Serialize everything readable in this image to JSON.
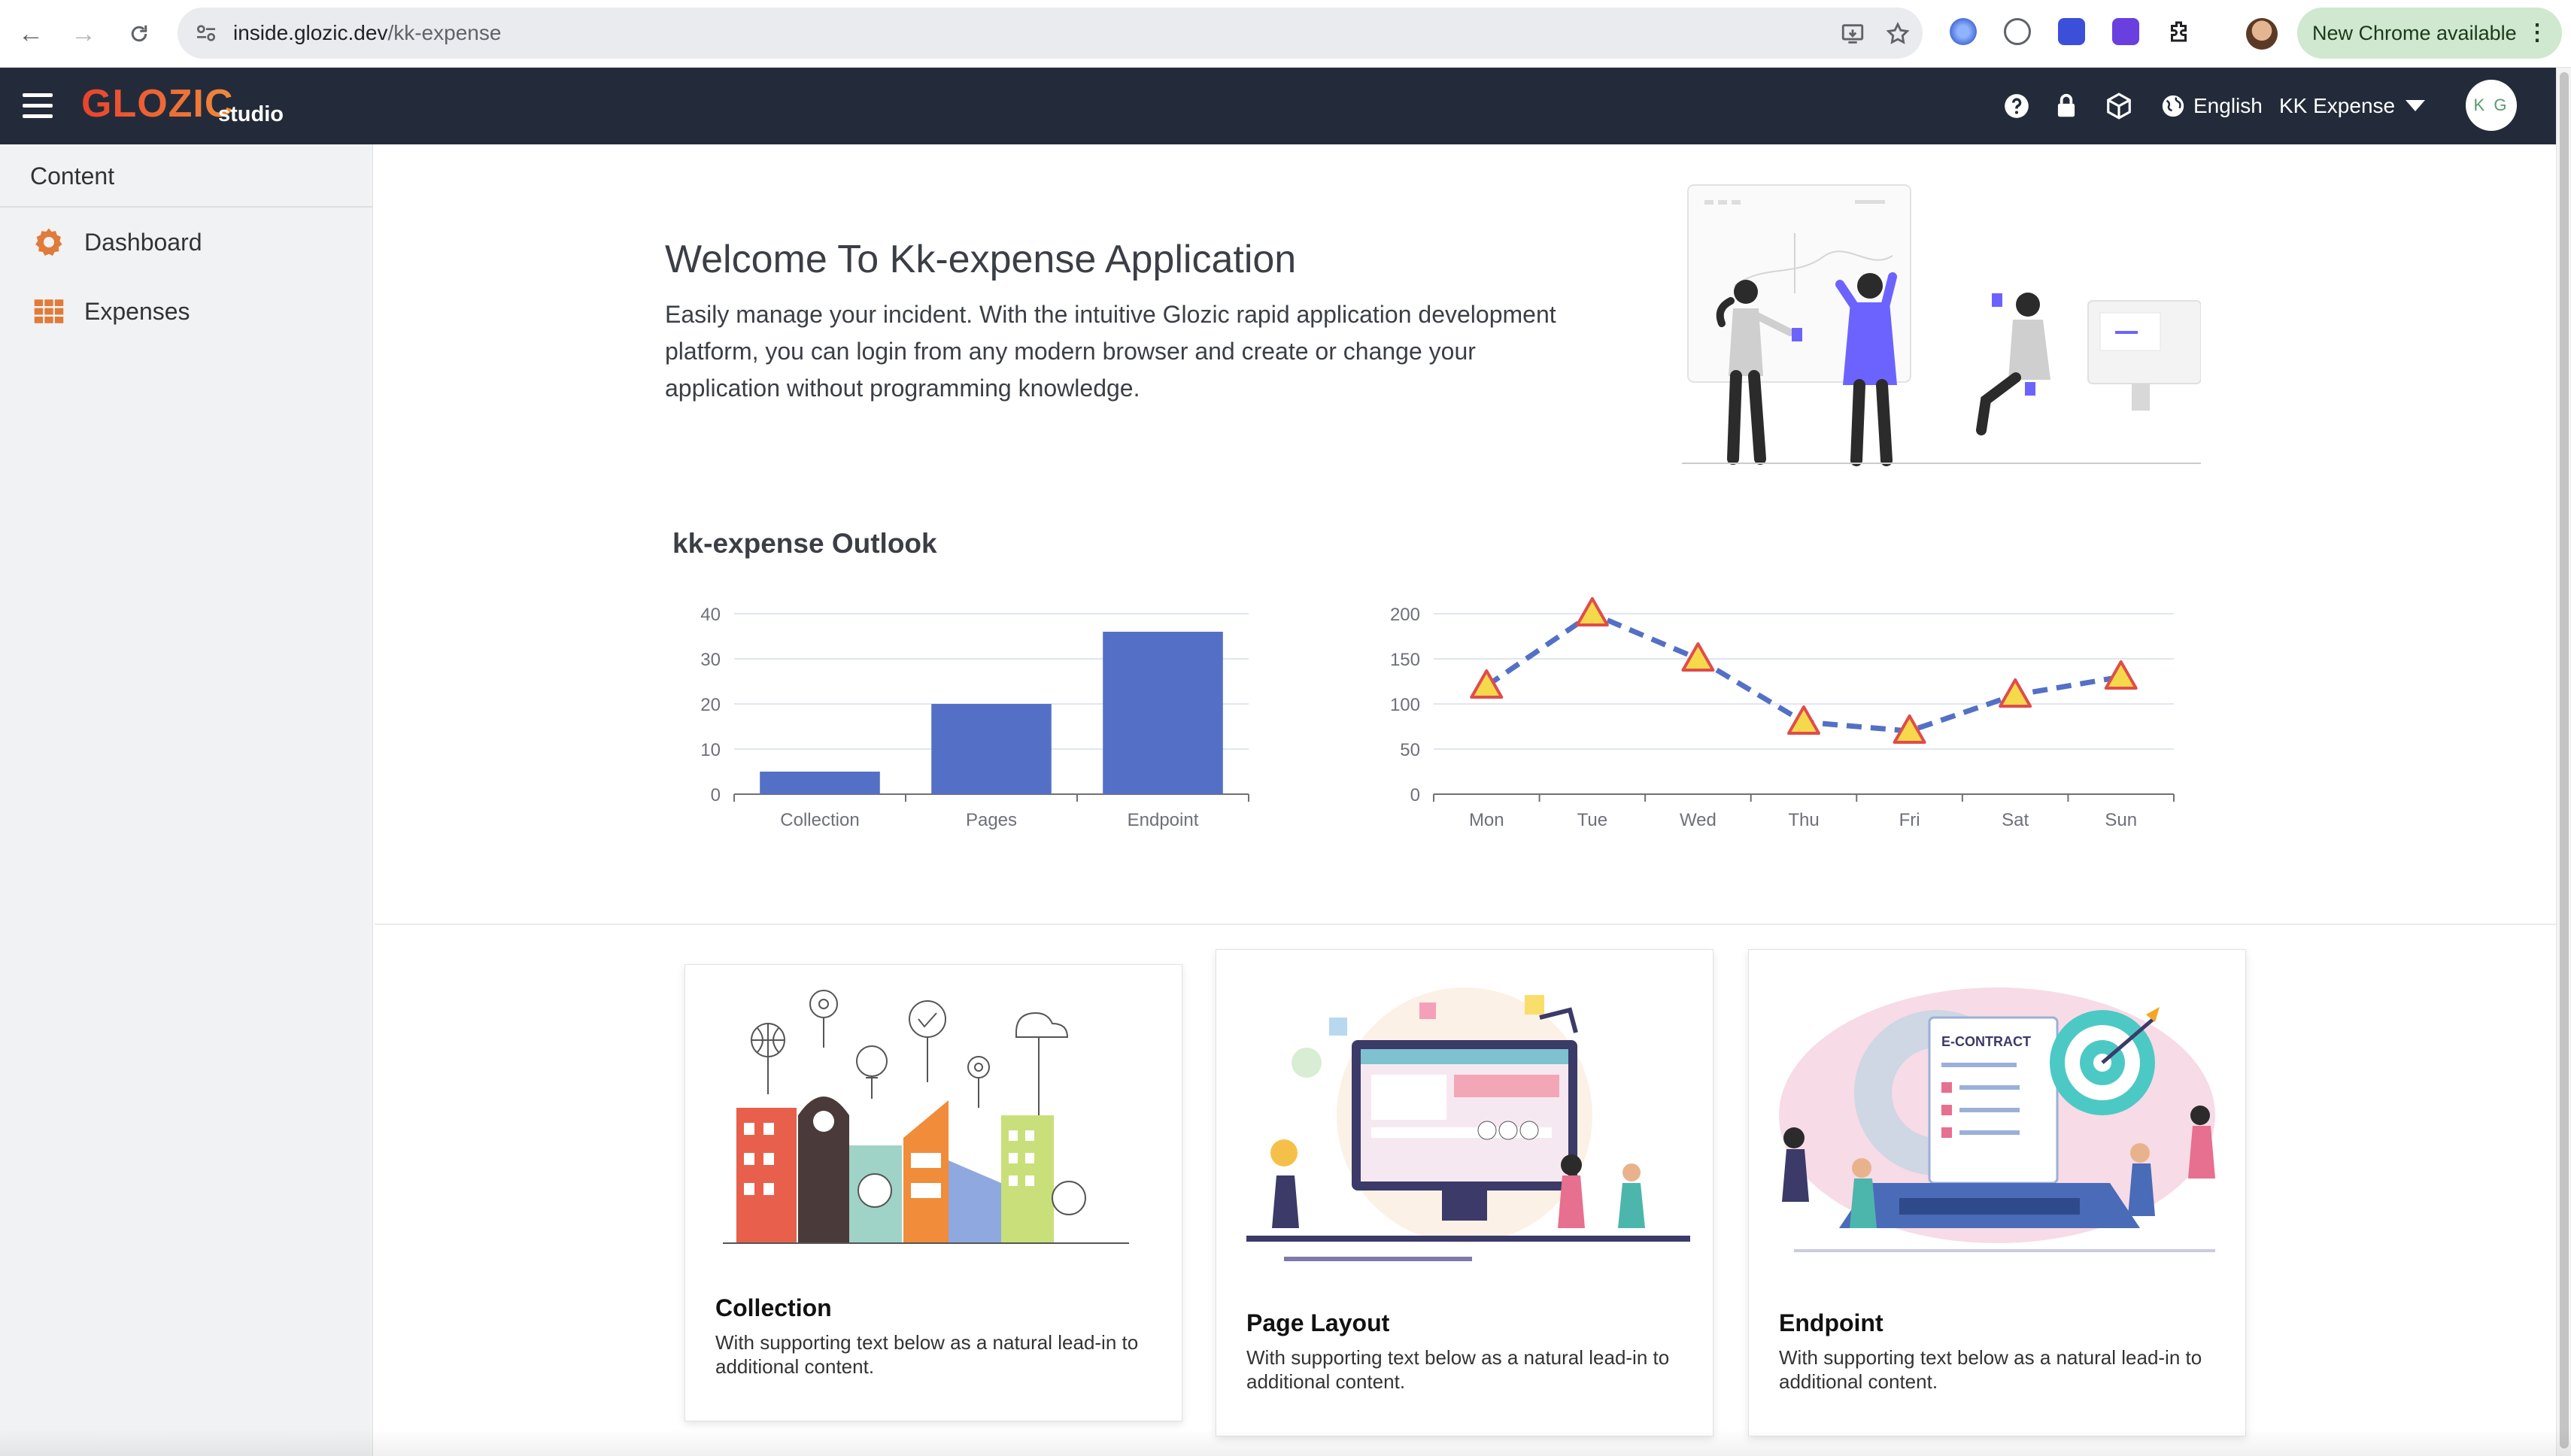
{
  "browser": {
    "url_host": "inside.glozic.dev",
    "url_path": "/kk-expense",
    "update_label": "New Chrome available"
  },
  "header": {
    "logo": "GLOZIC",
    "logo_sub": "studio",
    "language": "English",
    "app_name": "KK Expense",
    "user_initials": "K G"
  },
  "sidebar": {
    "title": "Content",
    "items": [
      {
        "label": "Dashboard",
        "icon": "gear-icon"
      },
      {
        "label": "Expenses",
        "icon": "grid-icon"
      }
    ]
  },
  "welcome": {
    "title": "Welcome To Kk-expense Application",
    "text": "Easily manage your incident. With the intuitive Glozic rapid application development platform, you can login from any modern browser and create or change your application without programming knowledge."
  },
  "outlook": {
    "title": "kk-expense Outlook"
  },
  "chart_data": [
    {
      "type": "bar",
      "categories": [
        "Collection",
        "Pages",
        "Endpoint"
      ],
      "values": [
        5,
        20,
        36
      ],
      "ylim": [
        0,
        40
      ],
      "yticks": [
        0,
        10,
        20,
        30,
        40
      ],
      "color": "#5470c6"
    },
    {
      "type": "line",
      "categories": [
        "Mon",
        "Tue",
        "Wed",
        "Thu",
        "Fri",
        "Sat",
        "Sun"
      ],
      "values": [
        120,
        200,
        150,
        80,
        70,
        110,
        130
      ],
      "ylim": [
        0,
        200
      ],
      "yticks": [
        0,
        50,
        100,
        150,
        200
      ],
      "line_style": "dashed",
      "marker": "triangle",
      "color": "#5470c6",
      "marker_fill": "#f5d94a",
      "marker_stroke": "#e04c4c"
    }
  ],
  "cards": [
    {
      "title": "Collection",
      "text": "With supporting text below as a natural lead-in to additional content."
    },
    {
      "title": "Page Layout",
      "text": "With supporting text below as a natural lead-in to additional content."
    },
    {
      "title": "Endpoint",
      "text": "With supporting text below as a natural lead-in to additional content."
    }
  ],
  "colors": {
    "header_bg": "#232b3a",
    "accent": "#5470c6",
    "logo": "#e9422d",
    "sidebar_icon": "#e07b39"
  }
}
